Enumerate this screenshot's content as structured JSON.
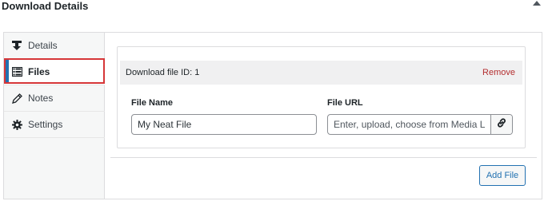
{
  "panel": {
    "title": "Download Details"
  },
  "tabs": [
    {
      "label": "Details",
      "icon": "download-icon"
    },
    {
      "label": "Files",
      "icon": "list-icon"
    },
    {
      "label": "Notes",
      "icon": "pencil-icon"
    },
    {
      "label": "Settings",
      "icon": "gear-icon"
    }
  ],
  "file": {
    "id_label": "Download file ID: 1",
    "remove_label": "Remove",
    "name_label": "File Name",
    "name_value": "My Neat File",
    "url_label": "File URL",
    "url_placeholder": "Enter, upload, choose from Media Library",
    "url_value": ""
  },
  "actions": {
    "add_file_label": "Add File"
  },
  "colors": {
    "accent": "#2271b1",
    "highlight": "#d63638",
    "remove": "#b32d2e",
    "sidebar_bg": "#f6f7f7"
  }
}
